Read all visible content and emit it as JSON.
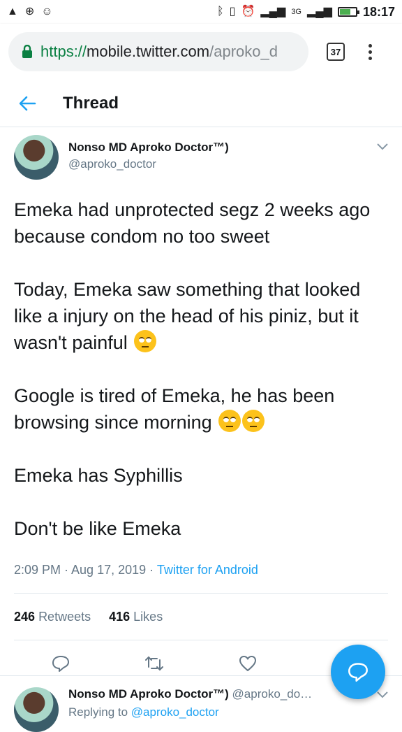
{
  "status_bar": {
    "time": "18:17",
    "network": "3G",
    "left_icons": [
      "warning-icon",
      "globe-icon",
      "message-icon"
    ],
    "right_icons": [
      "bluetooth-icon",
      "vibrate-icon",
      "alarm-icon",
      "signal-icon",
      "battery-icon"
    ]
  },
  "browser": {
    "url_scheme": "https://",
    "url_host": "mobile.twitter.com",
    "url_path": "/aproko_d",
    "tab_count": "37"
  },
  "header": {
    "title": "Thread"
  },
  "tweet": {
    "display_name": "Nonso MD Aproko Doctor™)",
    "handle": "@aproko_doctor",
    "paragraphs": [
      "Emeka had unprotected segz 2 weeks ago because condom no too sweet",
      "Today, Emeka saw something that looked like a injury on the head of his piniz, but it wasn't painful",
      "Google is tired of Emeka, he has been browsing since morning",
      "Emeka has Syphillis",
      "Don't be like Emeka"
    ],
    "timestamp": "2:09 PM · Aug 17, 2019 · ",
    "source": "Twitter for Android",
    "retweets_count": "246",
    "retweets_label": "Retweets",
    "likes_count": "416",
    "likes_label": "Likes"
  },
  "reply": {
    "display_name": "Nonso MD Aproko Doctor™)",
    "handle": "@aproko_do…",
    "replying_prefix": "Replying to ",
    "replying_to": "@aproko_doctor"
  },
  "colors": {
    "accent": "#1da1f2",
    "secure": "#0b8043"
  }
}
